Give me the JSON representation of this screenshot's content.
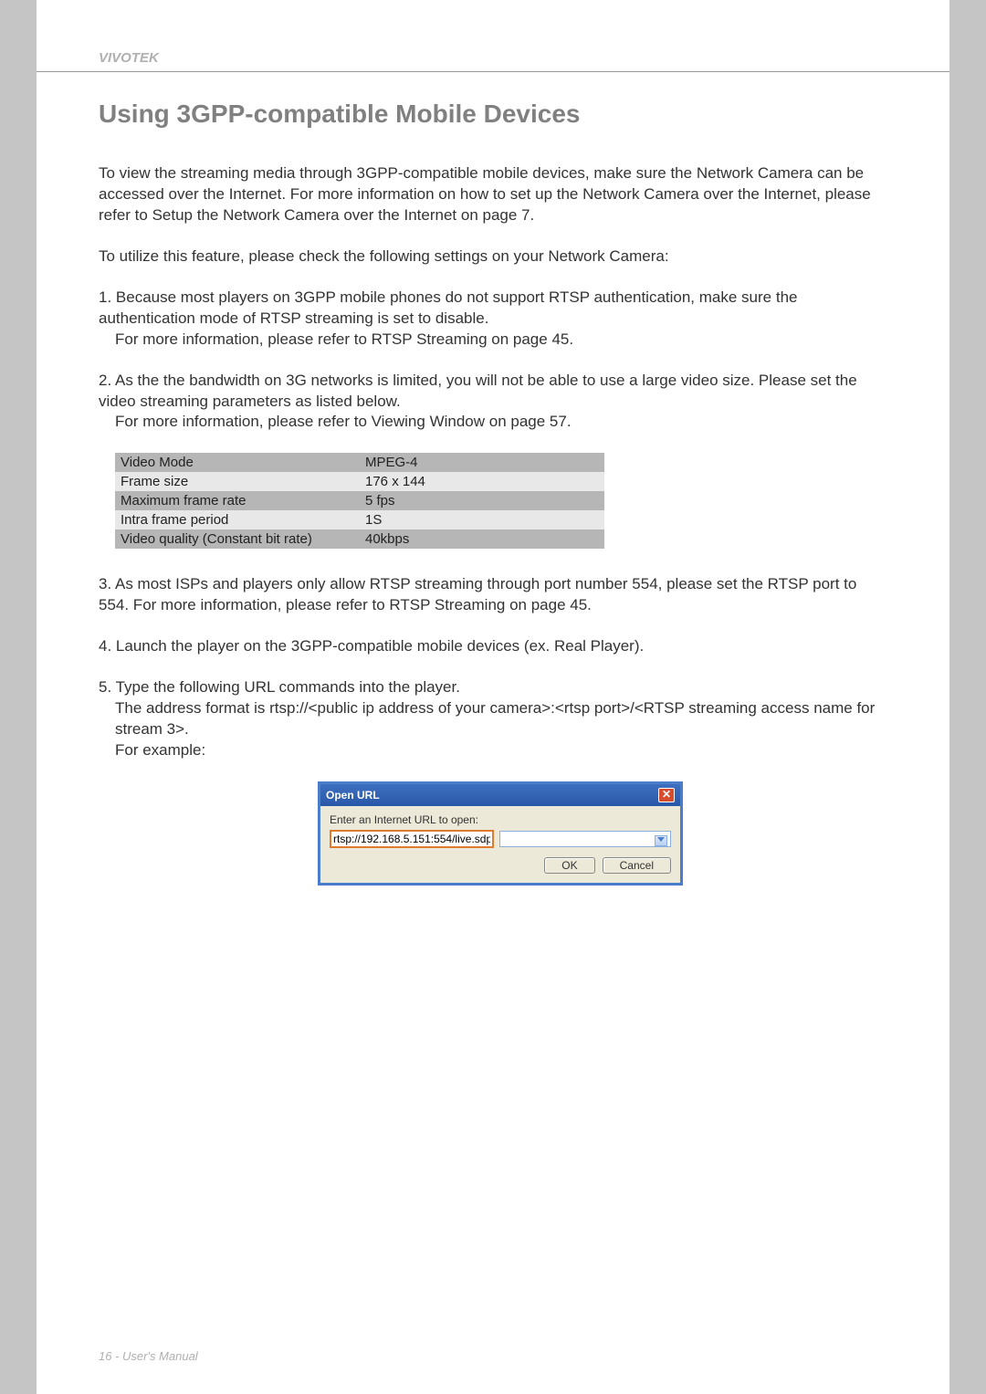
{
  "brand": "VIVOTEK",
  "title": "Using 3GPP-compatible Mobile Devices",
  "intro": "To view the streaming media through 3GPP-compatible mobile devices, make sure the Network Camera can be accessed over the Internet. For more information on how to set up the Network Camera over the Internet, please refer to Setup the Network Camera over the Internet on page 7.",
  "lead": "To utilize this feature, please check the following settings on your Network Camera:",
  "item1": {
    "num": "1.",
    "line1": "Because most players on 3GPP mobile phones do not support RTSP authentication, make sure the authentication mode of RTSP streaming is set to disable.",
    "line2": "For more information, please refer to RTSP Streaming on page 45."
  },
  "item2": {
    "num": "2.",
    "line1": "As the the bandwidth on 3G networks is limited, you will not be able to use a large video size. Please set the video streaming parameters as listed below.",
    "line2": "For more information, please refer to Viewing Window on page 57."
  },
  "settings": [
    {
      "key": "Video Mode",
      "val": "MPEG-4"
    },
    {
      "key": "Frame size",
      "val": "176 x 144"
    },
    {
      "key": "Maximum frame rate",
      "val": "5 fps"
    },
    {
      "key": "Intra frame period",
      "val": "1S"
    },
    {
      "key": "Video quality (Constant bit rate)",
      "val": "40kbps"
    }
  ],
  "item3": {
    "num": "3.",
    "text": "As most ISPs and players only allow RTSP streaming through port number 554, please set the RTSP port to 554. For more information, please refer to RTSP Streaming on page 45."
  },
  "item4": {
    "num": "4.",
    "text": "Launch the player on the 3GPP-compatible mobile devices (ex. Real Player)."
  },
  "item5": {
    "num": "5.",
    "line1": "Type the following URL commands into the player.",
    "line2": "The address format is rtsp://<public ip address of your camera>:<rtsp port>/<RTSP streaming access name for stream 3>.",
    "line3": "For example:"
  },
  "dialog": {
    "title": "Open URL",
    "label": "Enter an Internet URL to open:",
    "value": "rtsp://192.168.5.151:554/live.sdp",
    "ok": "OK",
    "cancel": "Cancel"
  },
  "footer": "16 - User's Manual"
}
